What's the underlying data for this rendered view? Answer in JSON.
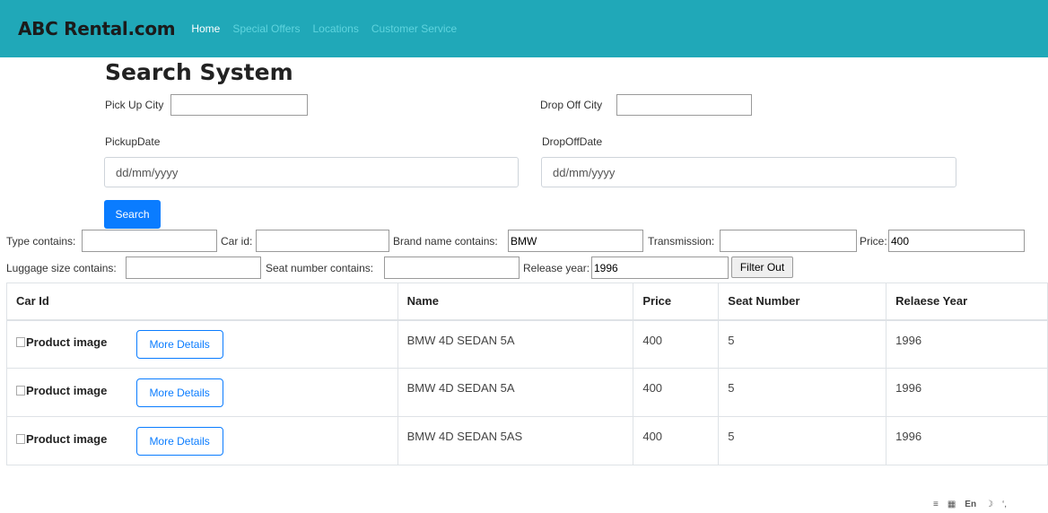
{
  "navbar": {
    "brand": "ABC Rental.com",
    "links": [
      "Home",
      "Special Offers",
      "Locations",
      "Customer Service"
    ]
  },
  "search": {
    "title": "Search System",
    "pickup_city_label": "Pick Up City",
    "pickup_city_value": "",
    "dropoff_city_label": "Drop Off City",
    "dropoff_city_value": "",
    "pickup_date_label": "PickupDate",
    "pickup_date_placeholder": "dd/mm/yyyy",
    "dropoff_date_label": "DropOffDate",
    "dropoff_date_placeholder": "dd/mm/yyyy",
    "search_button": "Search"
  },
  "filters": {
    "type_label": "Type contains:",
    "type_value": "",
    "car_id_label": "Car id:",
    "car_id_value": "",
    "brand_label": "Brand name contains:",
    "brand_value": "BMW",
    "transmission_label": "Transmission:",
    "transmission_value": "",
    "price_label": "Price:",
    "price_value": "400",
    "luggage_label": "Luggage size contains:",
    "luggage_value": "",
    "seat_label": "Seat number contains:",
    "seat_value": "",
    "release_label": "Release year:",
    "release_value": "1996",
    "filter_button": "Filter Out"
  },
  "table": {
    "headers": [
      "Car Id",
      "Name",
      "Price",
      "Seat Number",
      "Relaese Year"
    ],
    "image_alt": "Product image",
    "details_button": "More Details",
    "rows": [
      {
        "name": "BMW 4D SEDAN 5A",
        "price": "400",
        "seats": "5",
        "year": "1996"
      },
      {
        "name": "BMW 4D SEDAN 5A",
        "price": "400",
        "seats": "5",
        "year": "1996"
      },
      {
        "name": "BMW 4D SEDAN 5AS",
        "price": "400",
        "seats": "5",
        "year": "1996"
      }
    ]
  },
  "tray": {
    "lang": "En"
  }
}
